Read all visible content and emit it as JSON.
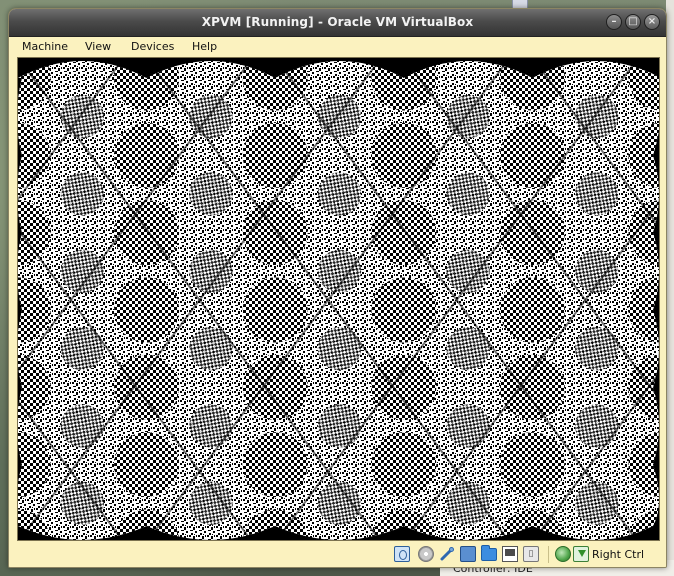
{
  "window": {
    "title": "XPVM [Running] - Oracle VM VirtualBox",
    "buttons": {
      "minimize_glyph": "–",
      "maximize_glyph": "□",
      "close_glyph": "×"
    }
  },
  "menubar": {
    "items": [
      {
        "label": "Machine"
      },
      {
        "label": "View"
      },
      {
        "label": "Devices"
      },
      {
        "label": "Help"
      }
    ]
  },
  "vm_screen": {
    "content": "guest-display",
    "background_color": "#000000",
    "pattern_colors": [
      "#ffffff",
      "#000000"
    ]
  },
  "statusbar": {
    "icons": [
      {
        "name": "hard-disk-icon"
      },
      {
        "name": "optical-drive-icon"
      },
      {
        "name": "usb-icon"
      },
      {
        "name": "network-icon"
      },
      {
        "name": "shared-folders-icon"
      },
      {
        "name": "display-icon"
      },
      {
        "name": "vt-x-icon",
        "glyph": "▯"
      },
      {
        "name": "mouse-integration-icon"
      },
      {
        "name": "keyboard-capture-icon"
      }
    ],
    "host_key_label": "Right Ctrl"
  },
  "desktop": {
    "background_text": "Controller: IDE"
  },
  "colors": {
    "window_bg": "#fbf2bf",
    "titlebar_dark": "#333333",
    "title_text": "#f2f2f2"
  }
}
